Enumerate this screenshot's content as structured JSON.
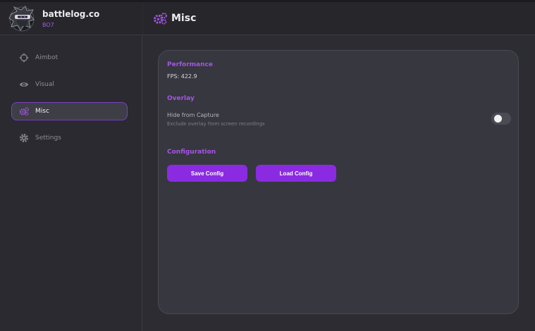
{
  "brand": {
    "name": "battlelog.co",
    "subtitle": "BO7"
  },
  "sidebar": {
    "items": [
      {
        "label": "Aimbot",
        "icon": "crosshair-icon",
        "active": false
      },
      {
        "label": "Visual",
        "icon": "eye-icon",
        "active": false
      },
      {
        "label": "Misc",
        "icon": "gears-icon",
        "active": true
      },
      {
        "label": "Settings",
        "icon": "gear-icon",
        "active": false
      }
    ]
  },
  "header": {
    "title": "Misc",
    "icon": "gears-icon"
  },
  "main": {
    "performance": {
      "title": "Performance",
      "fps_text": "FPS: 422.9"
    },
    "overlay": {
      "title": "Overlay",
      "hide_label": "Hide from Capture",
      "hide_desc": "Exclude overlay from screen recordings",
      "hide_enabled": false
    },
    "configuration": {
      "title": "Configuration",
      "save_label": "Save Config",
      "load_label": "Load Config"
    }
  },
  "colors": {
    "accent": "#8a2be2",
    "accent_text": "#a455e4",
    "background": "#2c2c32",
    "panel": "#37373f"
  }
}
